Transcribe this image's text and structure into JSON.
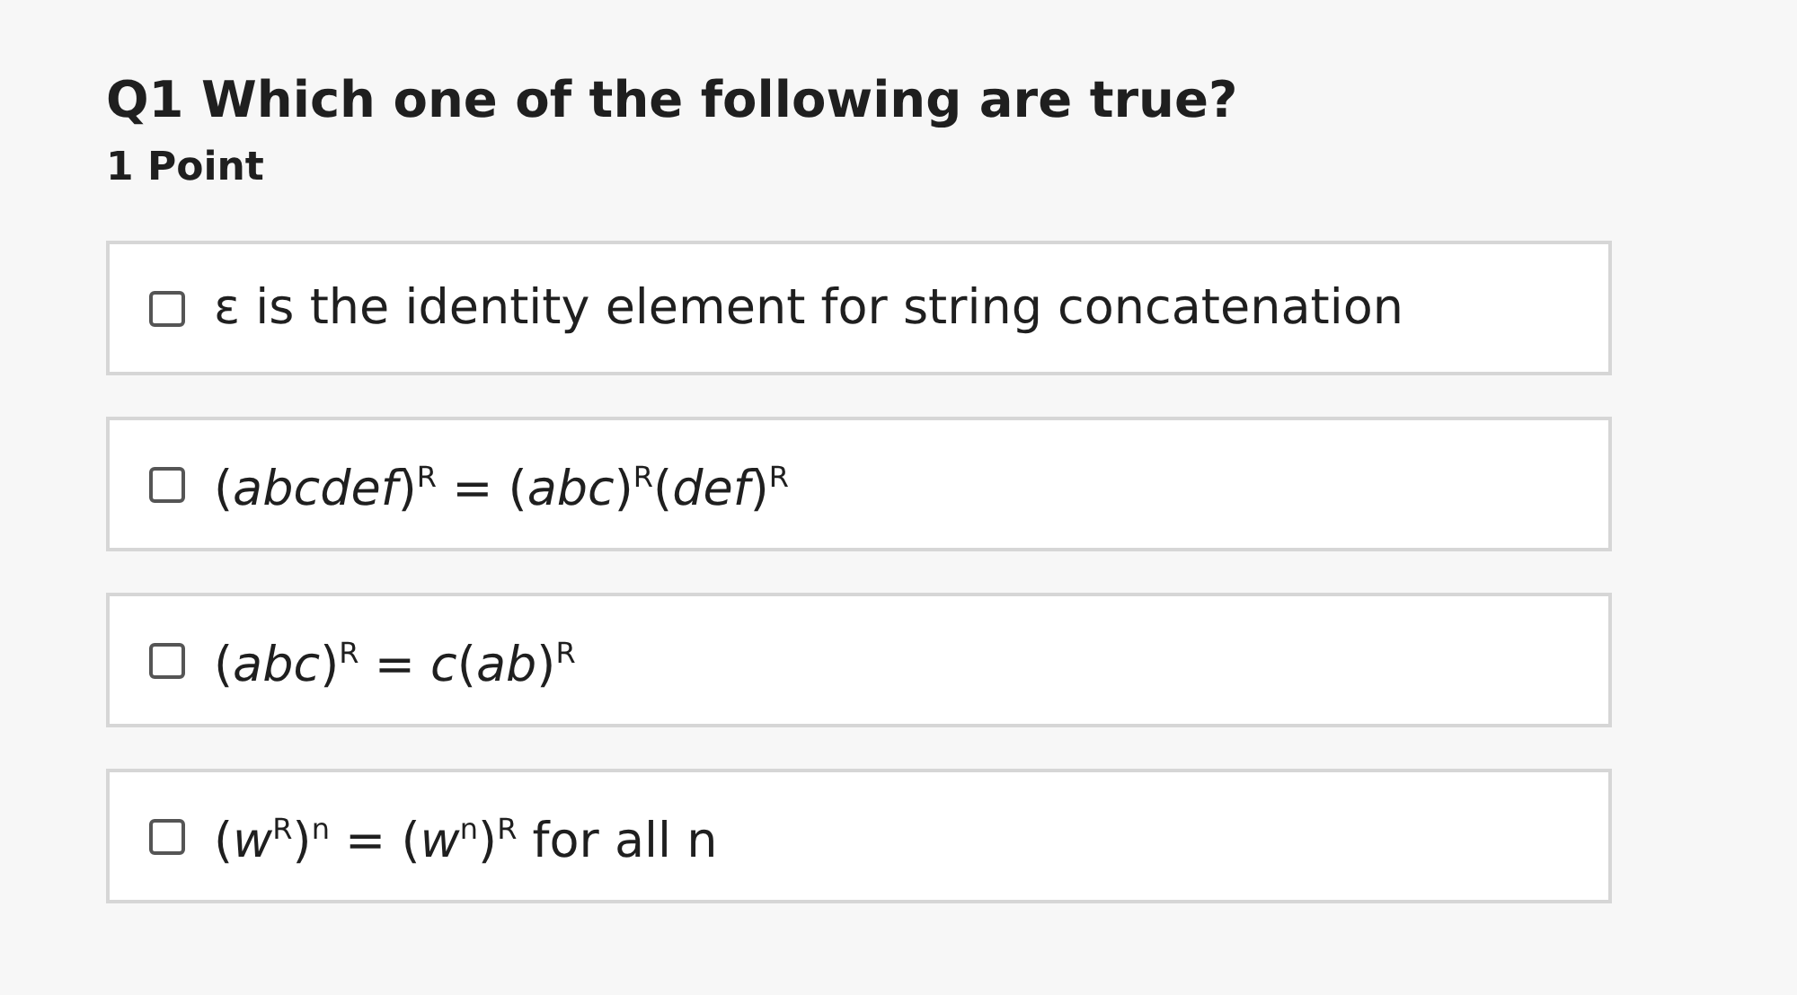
{
  "question": {
    "title": "Q1 Which one of the following are true?",
    "points": "1 Point"
  },
  "options": [
    {
      "text": "ε is the identity element for string concatenation",
      "checked": false
    },
    {
      "text": "(*abcdef*)$^{R}$ = (*abc*)$^{R}$(*def*)$^{R}$",
      "checked": false
    },
    {
      "text": "(*abc*)$^{R}$ = *c*(*ab*)$^{R}$",
      "checked": false
    },
    {
      "text": "(*w*$^{R}$)$^{n}$ = (*w*$^{n}$)$^{R}$ for all n",
      "checked": false
    }
  ]
}
